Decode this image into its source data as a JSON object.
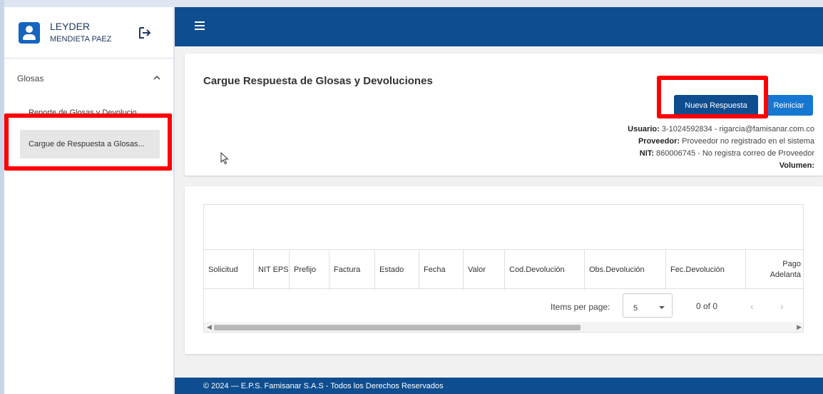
{
  "user": {
    "first_name": "LEYDER",
    "last_name": "MENDIETA PAEZ"
  },
  "sidebar": {
    "section_label": "Glosas",
    "items": [
      {
        "label": "Reporte de Glosas y Devolucio..."
      },
      {
        "label": "Cargue de Respuesta a Glosas..."
      }
    ]
  },
  "page": {
    "title": "Cargue Respuesta de Glosas y Devoluciones",
    "new_button": "Nueva Respuesta",
    "reset_button": "Reiniciar"
  },
  "info": {
    "usuario_label": "Usuario:",
    "usuario_value": "3-1024592834 - rigarcia@famisanar.com.co",
    "proveedor_label": "Proveedor:",
    "proveedor_value": "Proveedor no registrado en el sistema",
    "nit_label": "NIT:",
    "nit_value": "860006745 - No registra correo de Proveedor",
    "volumen_label": "Volumen:"
  },
  "table": {
    "columns": [
      "Solicitud",
      "NIT EPS",
      "Prefijo",
      "Factura",
      "Estado",
      "Fecha",
      "Valor",
      "Cod.Devolución",
      "Obs.Devolución",
      "Fec.Devolución",
      "Pago Adelanta"
    ]
  },
  "paginator": {
    "items_per_page_label": "Items per page:",
    "page_size": "5",
    "range": "0 of 0"
  },
  "footer": {
    "text": "© 2024 — E.P.S. Famisanar S.A.S - Todos los Derechos Reservados"
  },
  "colors": {
    "primary": "#0e4d8f",
    "accent": "#1677d2",
    "highlight": "#ff0000"
  }
}
